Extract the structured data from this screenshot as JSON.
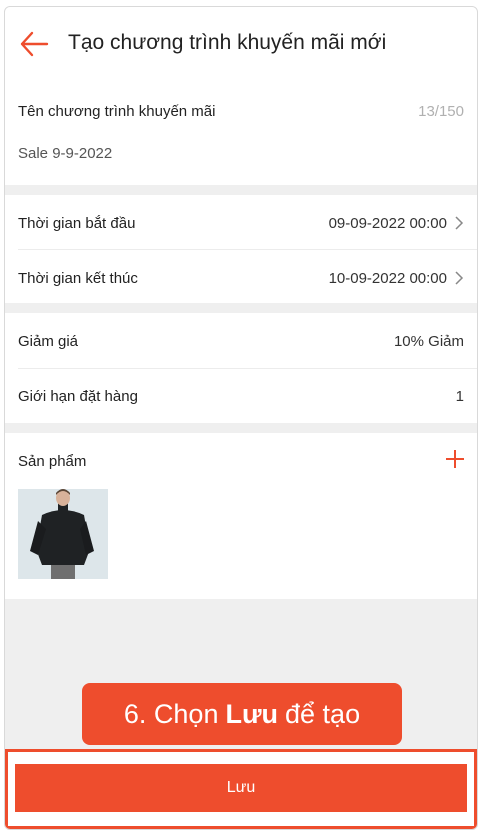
{
  "header": {
    "title": "Tạo chương trình khuyến mãi mới"
  },
  "name_section": {
    "label": "Tên chương trình khuyến mãi",
    "char_count": "13/150",
    "value": "Sale 9-9-2022"
  },
  "time_section": {
    "start_label": "Thời gian bắt đầu",
    "start_value": "09-09-2022 00:00",
    "end_label": "Thời gian kết thúc",
    "end_value": "10-09-2022 00:00"
  },
  "discount_section": {
    "discount_label": "Giảm giá",
    "discount_value": "10% Giảm",
    "limit_label": "Giới hạn đặt hàng",
    "limit_value": "1"
  },
  "products_section": {
    "label": "Sản phẩm"
  },
  "tooltip": {
    "prefix": "6. Chọn",
    "bold": "Lưu",
    "suffix": "để tạo"
  },
  "footer": {
    "save_label": "Lưu"
  },
  "colors": {
    "accent": "#ee4d2d",
    "background": "#efefef"
  }
}
